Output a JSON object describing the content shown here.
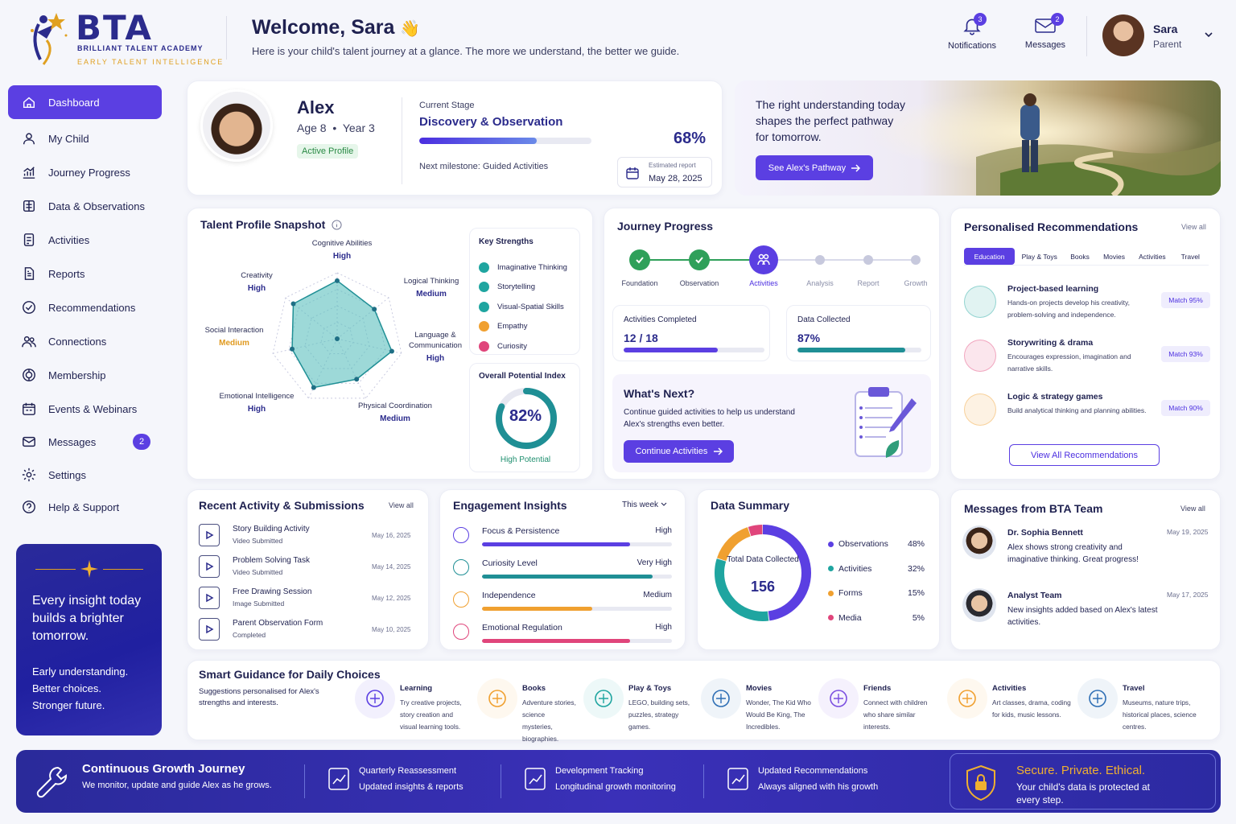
{
  "brand": {
    "logo_text": "BTA",
    "name": "BRILLIANT TALENT ACADEMY",
    "tagline": "EARLY TALENT INTELLIGENCE"
  },
  "header": {
    "welcome": "Welcome, Sara",
    "welcome_emoji": "👋",
    "subtitle": "Here is your child's talent journey at a glance. The more we understand, the better we guide.",
    "notifications_label": "Notifications",
    "notifications_count": "3",
    "messages_label": "Messages",
    "messages_count": "2",
    "user_name": "Sara",
    "user_role": "Parent"
  },
  "sidebar": {
    "items": [
      {
        "label": "Dashboard",
        "icon": "home-icon"
      },
      {
        "label": "My Child",
        "icon": "user-icon"
      },
      {
        "label": "Journey Progress",
        "icon": "chart-icon"
      },
      {
        "label": "Data & Observations",
        "icon": "data-icon"
      },
      {
        "label": "Activities",
        "icon": "activities-icon"
      },
      {
        "label": "Reports",
        "icon": "report-icon"
      },
      {
        "label": "Recommendations",
        "icon": "check-icon"
      },
      {
        "label": "Connections",
        "icon": "people-icon"
      },
      {
        "label": "Membership",
        "icon": "membership-icon"
      },
      {
        "label": "Events & Webinars",
        "icon": "calendar-icon"
      },
      {
        "label": "Messages",
        "icon": "mail-icon",
        "badge": "2"
      },
      {
        "label": "Settings",
        "icon": "gear-icon"
      },
      {
        "label": "Help & Support",
        "icon": "help-icon"
      }
    ],
    "promo": {
      "line1": "Every insight today builds a brighter tomorrow.",
      "line2": "Early understanding.",
      "line3": "Better choices.",
      "line4": "Stronger future."
    }
  },
  "profile": {
    "name": "Alex",
    "age": "Age 8",
    "year": "Year 3",
    "status": "Active Profile",
    "stage_label": "Current Stage",
    "stage": "Discovery & Observation",
    "progress": "68%",
    "progress_value": 68,
    "milestone": "Next milestone: Guided Activities",
    "report_label": "Estimated report",
    "report_date": "May 28, 2025"
  },
  "hero": {
    "text": "The right understanding today shapes the perfect pathway for tomorrow.",
    "button": "See Alex's Pathway"
  },
  "talent": {
    "title": "Talent Profile Snapshot",
    "axes": [
      {
        "name": "Cognitive Abilities",
        "level": "High",
        "value": 0.88
      },
      {
        "name": "Logical Thinking",
        "level": "Medium",
        "value": 0.72
      },
      {
        "name": "Language & Communication",
        "level": "High",
        "value": 0.85
      },
      {
        "name": "Physical Coordination",
        "level": "Medium",
        "value": 0.68
      },
      {
        "name": "Emotional Intelligence",
        "level": "High",
        "value": 0.82
      },
      {
        "name": "Social Interaction",
        "level": "Medium",
        "value": 0.7
      },
      {
        "name": "Creativity",
        "level": "High",
        "value": 0.85
      }
    ],
    "strengths_title": "Key Strengths",
    "strengths": [
      {
        "label": "Imaginative Thinking",
        "color": "#1fa5a0"
      },
      {
        "label": "Storytelling",
        "color": "#1fa5a0"
      },
      {
        "label": "Visual-Spatial Skills",
        "color": "#1fa5a0"
      },
      {
        "label": "Empathy",
        "color": "#f0a030"
      },
      {
        "label": "Curiosity",
        "color": "#e0457b"
      }
    ],
    "potential_title": "Overall Potential Index",
    "potential_value": "82%",
    "potential_fraction": 0.82,
    "potential_label": "High Potential"
  },
  "journey": {
    "title": "Journey Progress",
    "steps": [
      {
        "label": "Foundation",
        "state": "done"
      },
      {
        "label": "Observation",
        "state": "done"
      },
      {
        "label": "Activities",
        "state": "current"
      },
      {
        "label": "Analysis",
        "state": "todo"
      },
      {
        "label": "Report",
        "state": "todo"
      },
      {
        "label": "Growth",
        "state": "todo"
      }
    ],
    "activities_label": "Activities Completed",
    "activities_value": "12 / 18",
    "activities_fraction": 0.667,
    "data_label": "Data Collected",
    "data_value": "87%",
    "data_fraction": 0.87,
    "next_title": "What's Next?",
    "next_text": "Continue guided activities to help us understand Alex's strengths even better.",
    "next_button": "Continue Activities"
  },
  "recs": {
    "title": "Personalised Recommendations",
    "view_all": "View all",
    "tabs": [
      "Education",
      "Play & Toys",
      "Books",
      "Movies",
      "Activities",
      "Travel"
    ],
    "items": [
      {
        "title": "Project-based learning",
        "desc": "Hands-on projects develop his creativity, problem-solving and independence.",
        "match": "Match 95%",
        "color": "#1fa5a0"
      },
      {
        "title": "Storywriting & drama",
        "desc": "Encourages expression, imagination and narrative skills.",
        "match": "Match 93%",
        "color": "#e0457b"
      },
      {
        "title": "Logic & strategy games",
        "desc": "Build analytical thinking and planning abilities.",
        "match": "Match 90%",
        "color": "#f0a030"
      }
    ],
    "button": "View All Recommendations"
  },
  "recent": {
    "title": "Recent Activity & Submissions",
    "view_all": "View all",
    "items": [
      {
        "title": "Story Building Activity",
        "sub": "Video Submitted",
        "date": "May 16, 2025"
      },
      {
        "title": "Problem Solving Task",
        "sub": "Video Submitted",
        "date": "May 14, 2025"
      },
      {
        "title": "Free Drawing Session",
        "sub": "Image Submitted",
        "date": "May 12, 2025"
      },
      {
        "title": "Parent Observation Form",
        "sub": "Completed",
        "date": "May 10, 2025"
      }
    ]
  },
  "engagement": {
    "title": "Engagement Insights",
    "period": "This week",
    "items": [
      {
        "label": "Focus & Persistence",
        "level": "High",
        "value": 0.78,
        "color": "#5b3fe2"
      },
      {
        "label": "Curiosity Level",
        "level": "Very High",
        "value": 0.9,
        "color": "#1f8f95"
      },
      {
        "label": "Independence",
        "level": "Medium",
        "value": 0.58,
        "color": "#f0a030"
      },
      {
        "label": "Emotional Regulation",
        "level": "High",
        "value": 0.78,
        "color": "#e0457b"
      }
    ]
  },
  "summary": {
    "title": "Data Summary",
    "center_label": "Total Data Collected",
    "total": "156",
    "items": [
      {
        "label": "Observations",
        "pct": "48%",
        "value": 48,
        "color": "#5b3fe2"
      },
      {
        "label": "Activities",
        "pct": "32%",
        "value": 32,
        "color": "#1fa5a0"
      },
      {
        "label": "Forms",
        "pct": "15%",
        "value": 15,
        "color": "#f0a030"
      },
      {
        "label": "Media",
        "pct": "5%",
        "value": 5,
        "color": "#e0457b"
      }
    ]
  },
  "messages": {
    "title": "Messages from BTA Team",
    "view_all": "View all",
    "items": [
      {
        "name": "Dr. Sophia Bennett",
        "date": "May 19, 2025",
        "text": "Alex shows strong creativity and imaginative thinking. Great progress!"
      },
      {
        "name": "Analyst Team",
        "date": "May 17, 2025",
        "text": "New insights added based on Alex's latest activities."
      }
    ]
  },
  "guidance": {
    "title": "Smart Guidance for Daily Choices",
    "subtitle": "Suggestions personalised for Alex's strengths and interests.",
    "items": [
      {
        "title": "Learning",
        "desc": "Try creative projects, story creation and visual learning tools.",
        "color": "#5b3fe2",
        "icon": "graduation-cap-icon"
      },
      {
        "title": "Books",
        "desc": "Adventure stories, science mysteries, biographies.",
        "color": "#f0a030",
        "icon": "book-icon"
      },
      {
        "title": "Play & Toys",
        "desc": "LEGO, building sets, puzzles, strategy games.",
        "color": "#1fa5a0",
        "icon": "puzzle-icon"
      },
      {
        "title": "Movies",
        "desc": "Wonder, The Kid Who Would Be King, The Incredibles.",
        "color": "#2f6fb5",
        "icon": "clapperboard-icon"
      },
      {
        "title": "Friends",
        "desc": "Connect with children who share similar interests.",
        "color": "#7b4fe0",
        "icon": "friends-icon"
      },
      {
        "title": "Activities",
        "desc": "Art classes, drama, coding for kids, music lessons.",
        "color": "#f0a030",
        "icon": "palette-icon"
      },
      {
        "title": "Travel",
        "desc": "Museums, nature trips, historical places, science centres.",
        "color": "#2f6fb5",
        "icon": "plane-icon"
      }
    ]
  },
  "footer": {
    "title": "Continuous Growth Journey",
    "sub": "We monitor, update and guide Alex as he grows.",
    "items": [
      {
        "title": "Quarterly Reassessment",
        "sub": "Updated insights & reports"
      },
      {
        "title": "Development Tracking",
        "sub": "Longitudinal growth monitoring"
      },
      {
        "title": "Updated Recommendations",
        "sub": "Always aligned with his growth"
      }
    ],
    "secure_title": "Secure. Private. Ethical.",
    "secure_text": "Your child's data is protected at every step."
  }
}
